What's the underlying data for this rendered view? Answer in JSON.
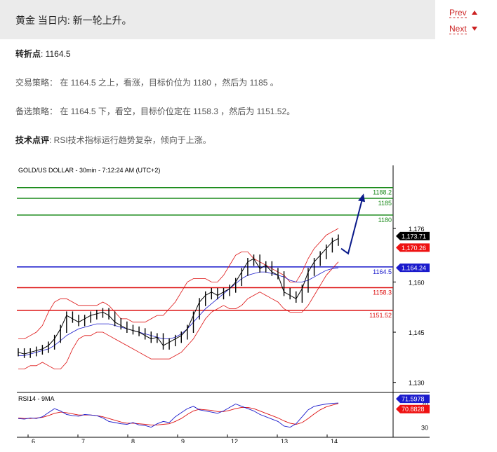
{
  "header": {
    "title": "黄金 当日内: 新一轮上升。",
    "prev_label": "Prev",
    "next_label": "Next"
  },
  "article": {
    "pivot_label": "转折点",
    "pivot_value": ": 1164.5",
    "strategy_label": "交易策略：",
    "strategy_text": " 在 1164.5 之上，看涨，目标价位为 1180 ，然后为 1185 。",
    "alt_label": "备选策略：",
    "alt_text": " 在 1164.5 下，看空，目标价位定在 1158.3 ，然后为 1151.52。",
    "tech_label": "技术点评",
    "tech_text": ": RSI技术指标运行趋势复杂，倾向于上涨。"
  },
  "colors": {
    "resistance": "#1a8a1a",
    "pivot": "#1a1acc",
    "support": "#dd1111",
    "arrow": "#0a1a8a",
    "last_price_bg": "#000000",
    "red_tag_bg": "#ee1111",
    "blue_tag_bg": "#1a1acc",
    "candles": "#000000",
    "bollinger": "#dd1111",
    "moving_average": "#1a1acc"
  },
  "chart_data": {
    "type": "line",
    "title": "GOLD/US DOLLAR - 30min - 7:12:24 AM (UTC+2)",
    "x_ticks": [
      "6",
      "7",
      "8",
      "9",
      "12",
      "13",
      "14"
    ],
    "y_ticks": [
      "1,176",
      "1,160",
      "1,145",
      "1,130"
    ],
    "ylim": [
      1127,
      1194
    ],
    "levels": [
      {
        "name": "resistance_3",
        "value": 1188.2,
        "label": "1188.2",
        "kind": "resistance"
      },
      {
        "name": "resistance_2",
        "value": 1185,
        "label": "1185",
        "kind": "resistance"
      },
      {
        "name": "resistance_1",
        "value": 1180,
        "label": "1180",
        "kind": "resistance"
      },
      {
        "name": "pivot",
        "value": 1164.5,
        "label": "1164.5",
        "kind": "pivot"
      },
      {
        "name": "support_1",
        "value": 1158.3,
        "label": "1158.3",
        "kind": "support"
      },
      {
        "name": "support_2",
        "value": 1151.52,
        "label": "1151.52",
        "kind": "support"
      }
    ],
    "price_tags": [
      {
        "name": "last-price",
        "value": 1173.71,
        "label": "1,173.71",
        "kind": "last"
      },
      {
        "name": "upper-band",
        "value": 1170.26,
        "label": "1,170.26",
        "kind": "red"
      },
      {
        "name": "ma-value",
        "value": 1164.24,
        "label": "1,164.24",
        "kind": "blue"
      }
    ],
    "price_series": [
      1139,
      1138.5,
      1139,
      1139.5,
      1140,
      1141,
      1143,
      1146,
      1150,
      1149,
      1148,
      1149,
      1150,
      1150.5,
      1151,
      1150,
      1148,
      1147,
      1146,
      1145.5,
      1145,
      1144,
      1143,
      1143.5,
      1141,
      1142,
      1143,
      1144,
      1146,
      1150,
      1154,
      1156,
      1157,
      1156,
      1157,
      1158,
      1160,
      1163,
      1166,
      1167,
      1164,
      1165,
      1163,
      1162,
      1157,
      1156,
      1155,
      1158,
      1163,
      1166,
      1168,
      1170,
      1172,
      1173
    ],
    "upper_band": [
      1143,
      1143,
      1144,
      1145,
      1147,
      1151,
      1154,
      1155,
      1155,
      1154,
      1153,
      1153,
      1153,
      1153,
      1154,
      1153,
      1151,
      1149,
      1149,
      1148,
      1148,
      1148,
      1149,
      1150,
      1150,
      1152,
      1154,
      1157,
      1160,
      1161,
      1161,
      1161,
      1160,
      1160,
      1162,
      1165,
      1168,
      1169,
      1169,
      1167,
      1166,
      1165,
      1164,
      1163,
      1162,
      1160,
      1160,
      1163,
      1167,
      1170,
      1172,
      1174,
      1175,
      1176
    ],
    "lower_band": [
      1134,
      1134,
      1135,
      1135,
      1136,
      1135,
      1134,
      1134,
      1136,
      1140,
      1143,
      1144,
      1144,
      1145,
      1145,
      1144,
      1143,
      1142,
      1141,
      1140,
      1139,
      1138,
      1137,
      1137,
      1137,
      1137,
      1138,
      1139,
      1141,
      1143,
      1146,
      1149,
      1151,
      1152,
      1153,
      1152,
      1152,
      1153,
      1155,
      1156,
      1157,
      1156,
      1155,
      1154,
      1152,
      1151,
      1151,
      1151,
      1153,
      1156,
      1159,
      1162,
      1164,
      1166
    ],
    "moving_average": [
      1138,
      1138,
      1138.5,
      1139,
      1139.5,
      1140,
      1141,
      1142.5,
      1144,
      1145,
      1146,
      1146.5,
      1147,
      1147.5,
      1147.5,
      1147.5,
      1147,
      1146.5,
      1146,
      1145.5,
      1145,
      1144.5,
      1144,
      1143.5,
      1143,
      1143,
      1143.5,
      1144.5,
      1146,
      1148,
      1150,
      1152,
      1153.5,
      1155,
      1156.5,
      1158,
      1159.5,
      1161,
      1162,
      1162.5,
      1163,
      1163,
      1162.5,
      1162,
      1161.5,
      1160.5,
      1160,
      1160,
      1160.5,
      1161.5,
      1162.5,
      1163.5,
      1164,
      1164.2
    ],
    "forecast_arrow": {
      "from": [
        1170,
        1168.5
      ],
      "to": [
        1186
      ]
    },
    "rsi_panel": {
      "title": "RSI14 - 9MA",
      "y_ticks": [
        "70",
        "30"
      ],
      "ylim": [
        20,
        85
      ],
      "tags": [
        {
          "name": "rsi-value",
          "value": 71.5978,
          "label": "71.5978",
          "kind": "blue"
        },
        {
          "name": "rsi-ma-value",
          "value": 70.8828,
          "label": "70.8828",
          "kind": "red"
        }
      ],
      "rsi": [
        45,
        44,
        46,
        45,
        48,
        55,
        62,
        58,
        52,
        50,
        49,
        52,
        51,
        50,
        46,
        40,
        38,
        36,
        35,
        38,
        34,
        33,
        30,
        36,
        40,
        38,
        48,
        55,
        62,
        66,
        60,
        58,
        56,
        54,
        58,
        64,
        70,
        66,
        62,
        58,
        52,
        48,
        44,
        40,
        32,
        30,
        36,
        48,
        60,
        66,
        68,
        70,
        71,
        71.6
      ],
      "rsi_ma": [
        46,
        45,
        45,
        46,
        47,
        50,
        54,
        56,
        55,
        53,
        51,
        51,
        51,
        50,
        48,
        45,
        42,
        39,
        37,
        37,
        36,
        35,
        34,
        34,
        35,
        36,
        40,
        45,
        52,
        58,
        61,
        60,
        59,
        57,
        57,
        59,
        62,
        64,
        64,
        62,
        58,
        54,
        50,
        46,
        41,
        37,
        35,
        38,
        45,
        53,
        60,
        65,
        68,
        70.9
      ]
    }
  }
}
